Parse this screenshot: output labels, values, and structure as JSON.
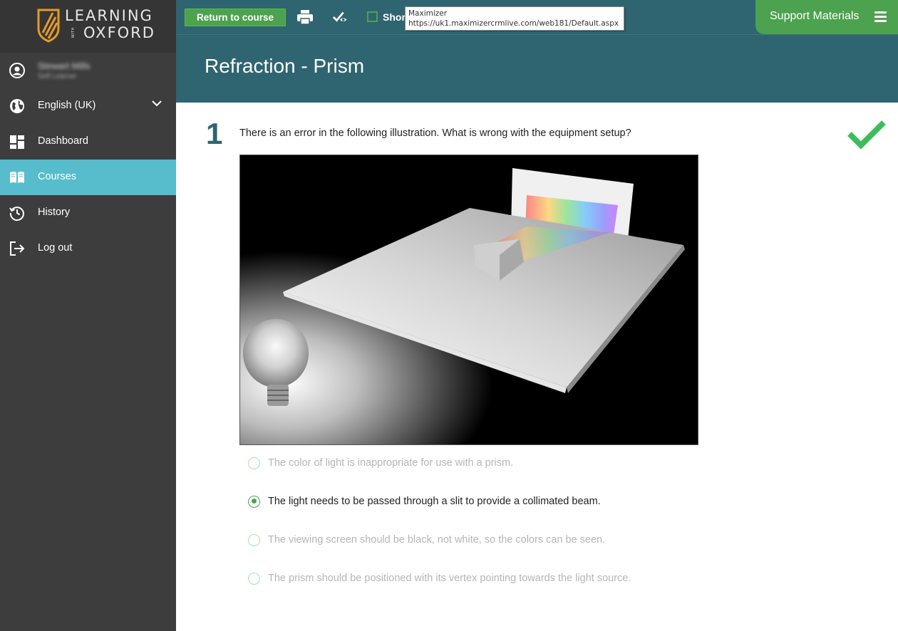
{
  "logo": {
    "line1": "LEARNING",
    "with": "WITH",
    "line2": "OXFORD"
  },
  "sidebar": {
    "user": {
      "name": "Stewart Mills",
      "subtitle": "Self Learner"
    },
    "items": [
      {
        "label": "English (UK)",
        "icon": "globe-icon"
      },
      {
        "label": "Dashboard",
        "icon": "dashboard-icon"
      },
      {
        "label": "Courses",
        "icon": "book-icon"
      },
      {
        "label": "History",
        "icon": "history-icon"
      },
      {
        "label": "Log out",
        "icon": "logout-icon"
      }
    ]
  },
  "toolbar": {
    "return_label": "Return to course",
    "show_label": "Shor",
    "support_label": "Support Materials"
  },
  "tooltip": {
    "title": "Maximizer",
    "url": "https://uk1.maximizercrmlive.com/web181/Default.aspx"
  },
  "page": {
    "title": "Refraction - Prism"
  },
  "question": {
    "number": "1",
    "text": "There is an error in the following illustration. What is wrong with the equipment setup?",
    "status": "correct",
    "options": [
      {
        "label": "The color of light is inappropriate for use with a prism.",
        "selected": false
      },
      {
        "label": "The light needs to be passed through a slit to provide a collimated beam.",
        "selected": true
      },
      {
        "label": "The viewing screen should be black, not white, so the colors can be seen.",
        "selected": false
      },
      {
        "label": "The prism should be positioned with its vertex pointing towards the light source.",
        "selected": false
      }
    ]
  },
  "colors": {
    "accent_green": "#4ca24e",
    "teal": "#2f6570",
    "active_nav": "#57bccb"
  }
}
